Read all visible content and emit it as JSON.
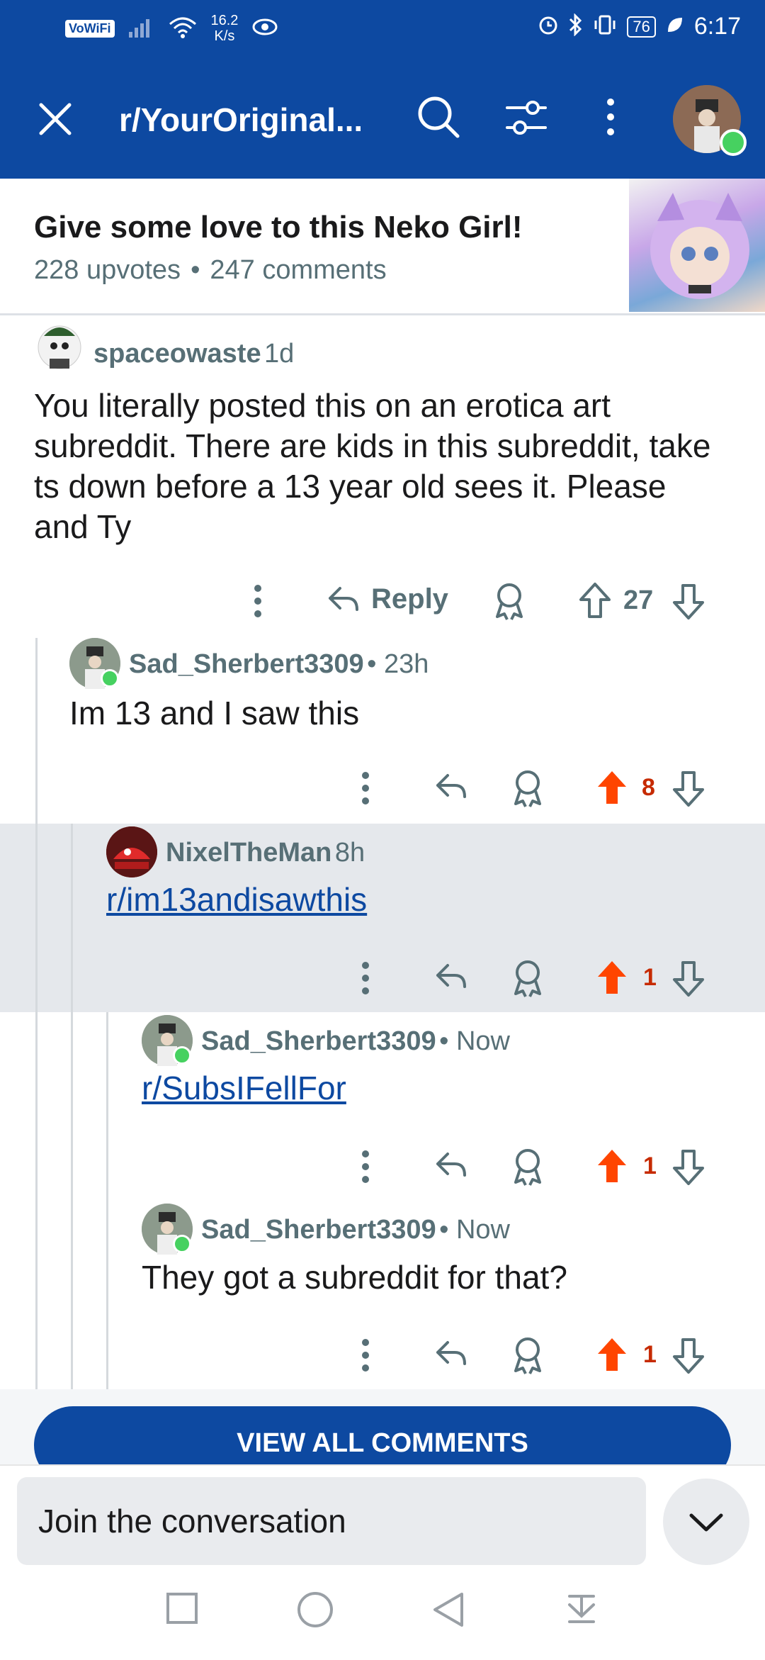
{
  "status_bar": {
    "network_badge": "VoWiFi",
    "speed_value": "16.2",
    "speed_unit": "K/s",
    "battery": "76",
    "time": "6:17"
  },
  "app_bar": {
    "title": "r/YourOriginal..."
  },
  "post": {
    "title": "Give some love to this Neko Girl!",
    "upvotes": "228 upvotes",
    "separator": "•",
    "comments": "247 comments"
  },
  "comments": [
    {
      "author": "spaceowaste",
      "time": "1d",
      "body": "You literally posted this on an erotica art subreddit. There are kids in this subreddit, take ts down before a 13 year old sees it. Please and Ty",
      "reply_label": "Reply",
      "score": "27",
      "upvoted": false
    },
    {
      "author": "Sad_Sherbert3309",
      "time": "• 23h",
      "body": "Im 13 and I saw this",
      "score": "8",
      "upvoted": true
    },
    {
      "author": "NixelTheMan",
      "time": "8h",
      "body": "r/im13andisawthis",
      "score": "1",
      "upvoted": true
    },
    {
      "author": "Sad_Sherbert3309",
      "time": "• Now",
      "body": "r/SubsIFellFor",
      "score": "1",
      "upvoted": true
    },
    {
      "author": "Sad_Sherbert3309",
      "time": "• Now",
      "body": "They got a subreddit for that?",
      "score": "1",
      "upvoted": true
    }
  ],
  "view_all_label": "VIEW ALL COMMENTS",
  "compose": {
    "placeholder": "Join the conversation"
  },
  "colors": {
    "brand_blue": "#0d49a1",
    "upvote_orange": "#ff4500",
    "meta_gray": "#576f76",
    "highlight": "#e5e8ec",
    "online_green": "#46d160"
  }
}
